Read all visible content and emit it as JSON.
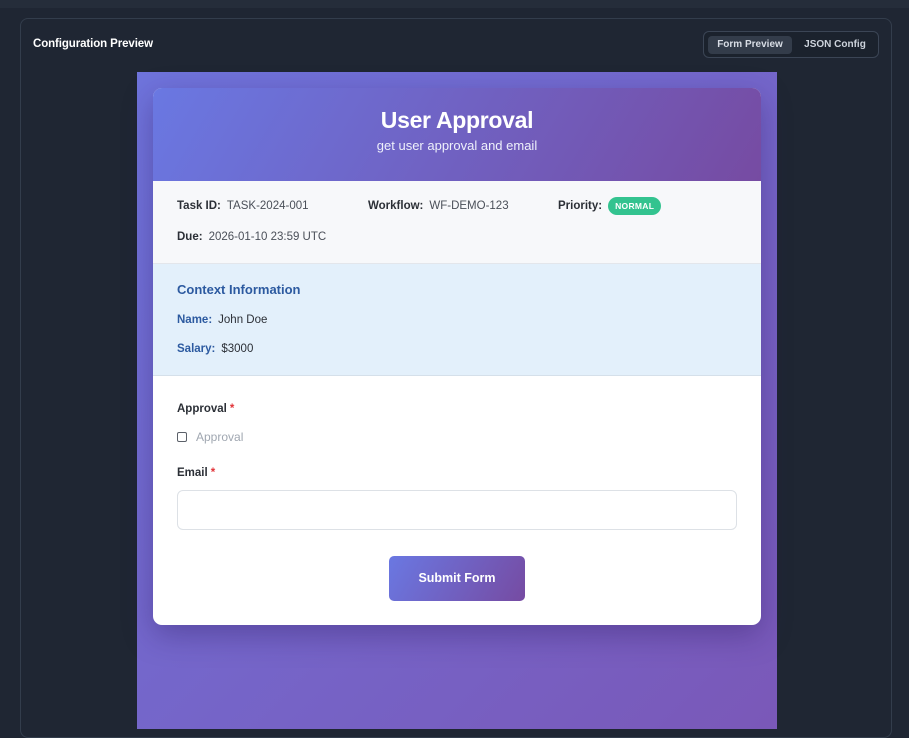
{
  "panel": {
    "title": "Configuration Preview",
    "tabs": [
      {
        "label": "Form Preview",
        "active": true
      },
      {
        "label": "JSON Config",
        "active": false
      }
    ]
  },
  "form_card": {
    "title": "User Approval",
    "subtitle": "get user approval and email",
    "meta": {
      "task_id_label": "Task ID:",
      "task_id": "TASK-2024-001",
      "workflow_label": "Workflow:",
      "workflow": "WF-DEMO-123",
      "priority_label": "Priority:",
      "priority": "NORMAL",
      "due_label": "Due:",
      "due": "2026-01-10 23:59 UTC"
    },
    "context": {
      "title": "Context Information",
      "name_label": "Name:",
      "name": "John Doe",
      "salary_label": "Salary:",
      "salary": "$3000"
    },
    "fields": {
      "approval_label": "Approval",
      "approval_required": "*",
      "approval_checkbox_label": "Approval",
      "email_label": "Email",
      "email_required": "*",
      "email_value": ""
    },
    "submit_label": "Submit Form"
  },
  "colors": {
    "accent_start": "#6a78e2",
    "accent_end": "#764ba2",
    "priority_badge": "#33c38f",
    "context_title": "#2c5aa0",
    "required": "#e2353a"
  }
}
